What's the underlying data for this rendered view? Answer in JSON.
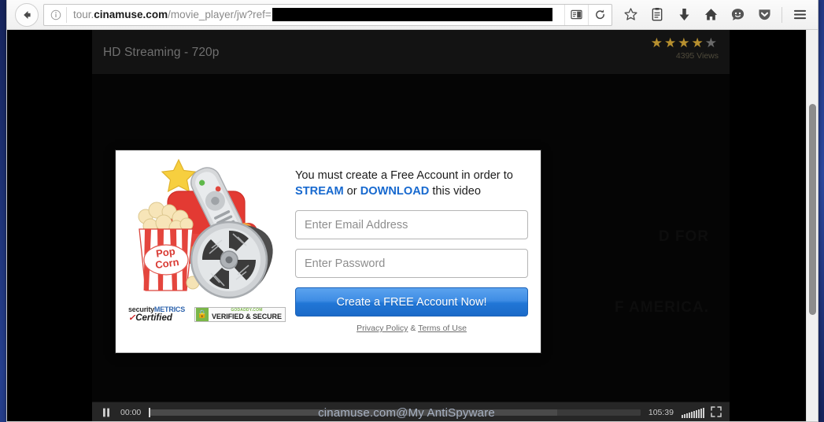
{
  "browser": {
    "back_label": "Back",
    "url": {
      "scheme_host_prefix": "tour.",
      "host": "cinamuse.com",
      "path": "/movie_player/jw?ref=",
      "redacted": true
    },
    "toolbar_icons": [
      "reader-view-icon",
      "reload-icon",
      "bookmark-star-icon",
      "library-icon",
      "downloads-icon",
      "home-icon",
      "sync-smiley-icon",
      "pocket-shield-icon",
      "hamburger-menu-icon"
    ]
  },
  "player": {
    "title": "HD Streaming - 720p",
    "stars_filled": 4,
    "stars_total": 5,
    "views": "4395 Views",
    "time_elapsed": "00:00",
    "time_duration": "105:39",
    "play_state": "paused",
    "background_text_line1": "D FOR",
    "background_text_line2": "F AMERICA."
  },
  "watermark": "cinamuse.com@My AntiSpyware",
  "modal": {
    "heading_part1": "You must create a Free Account in order to ",
    "heading_stream": "STREAM",
    "heading_or": " or ",
    "heading_download": "DOWNLOAD",
    "heading_part2": " this video",
    "email_placeholder": "Enter Email Address",
    "email_value": "",
    "password_placeholder": "Enter Password",
    "password_value": "",
    "cta_label": "Create a FREE Account Now!",
    "privacy_label": "Privacy Policy",
    "legal_separator": " & ",
    "terms_label": "Terms of Use",
    "badges": {
      "securitymetrics_line1_a": "security",
      "securitymetrics_line1_b": "METRICS",
      "securitymetrics_line2": "Certified",
      "godaddy_line1": "GODADDY.COM",
      "godaddy_line2": "VERIFIED & SECURE"
    },
    "illustration_name": "popcorn-armchair-filmreel-illustration"
  },
  "colors": {
    "cta_blue": "#2176d6",
    "link_blue": "#1769cf",
    "star_gold": "#b7902f",
    "star_gray": "#6a6a6a",
    "desktop_blue": "#26408f"
  }
}
